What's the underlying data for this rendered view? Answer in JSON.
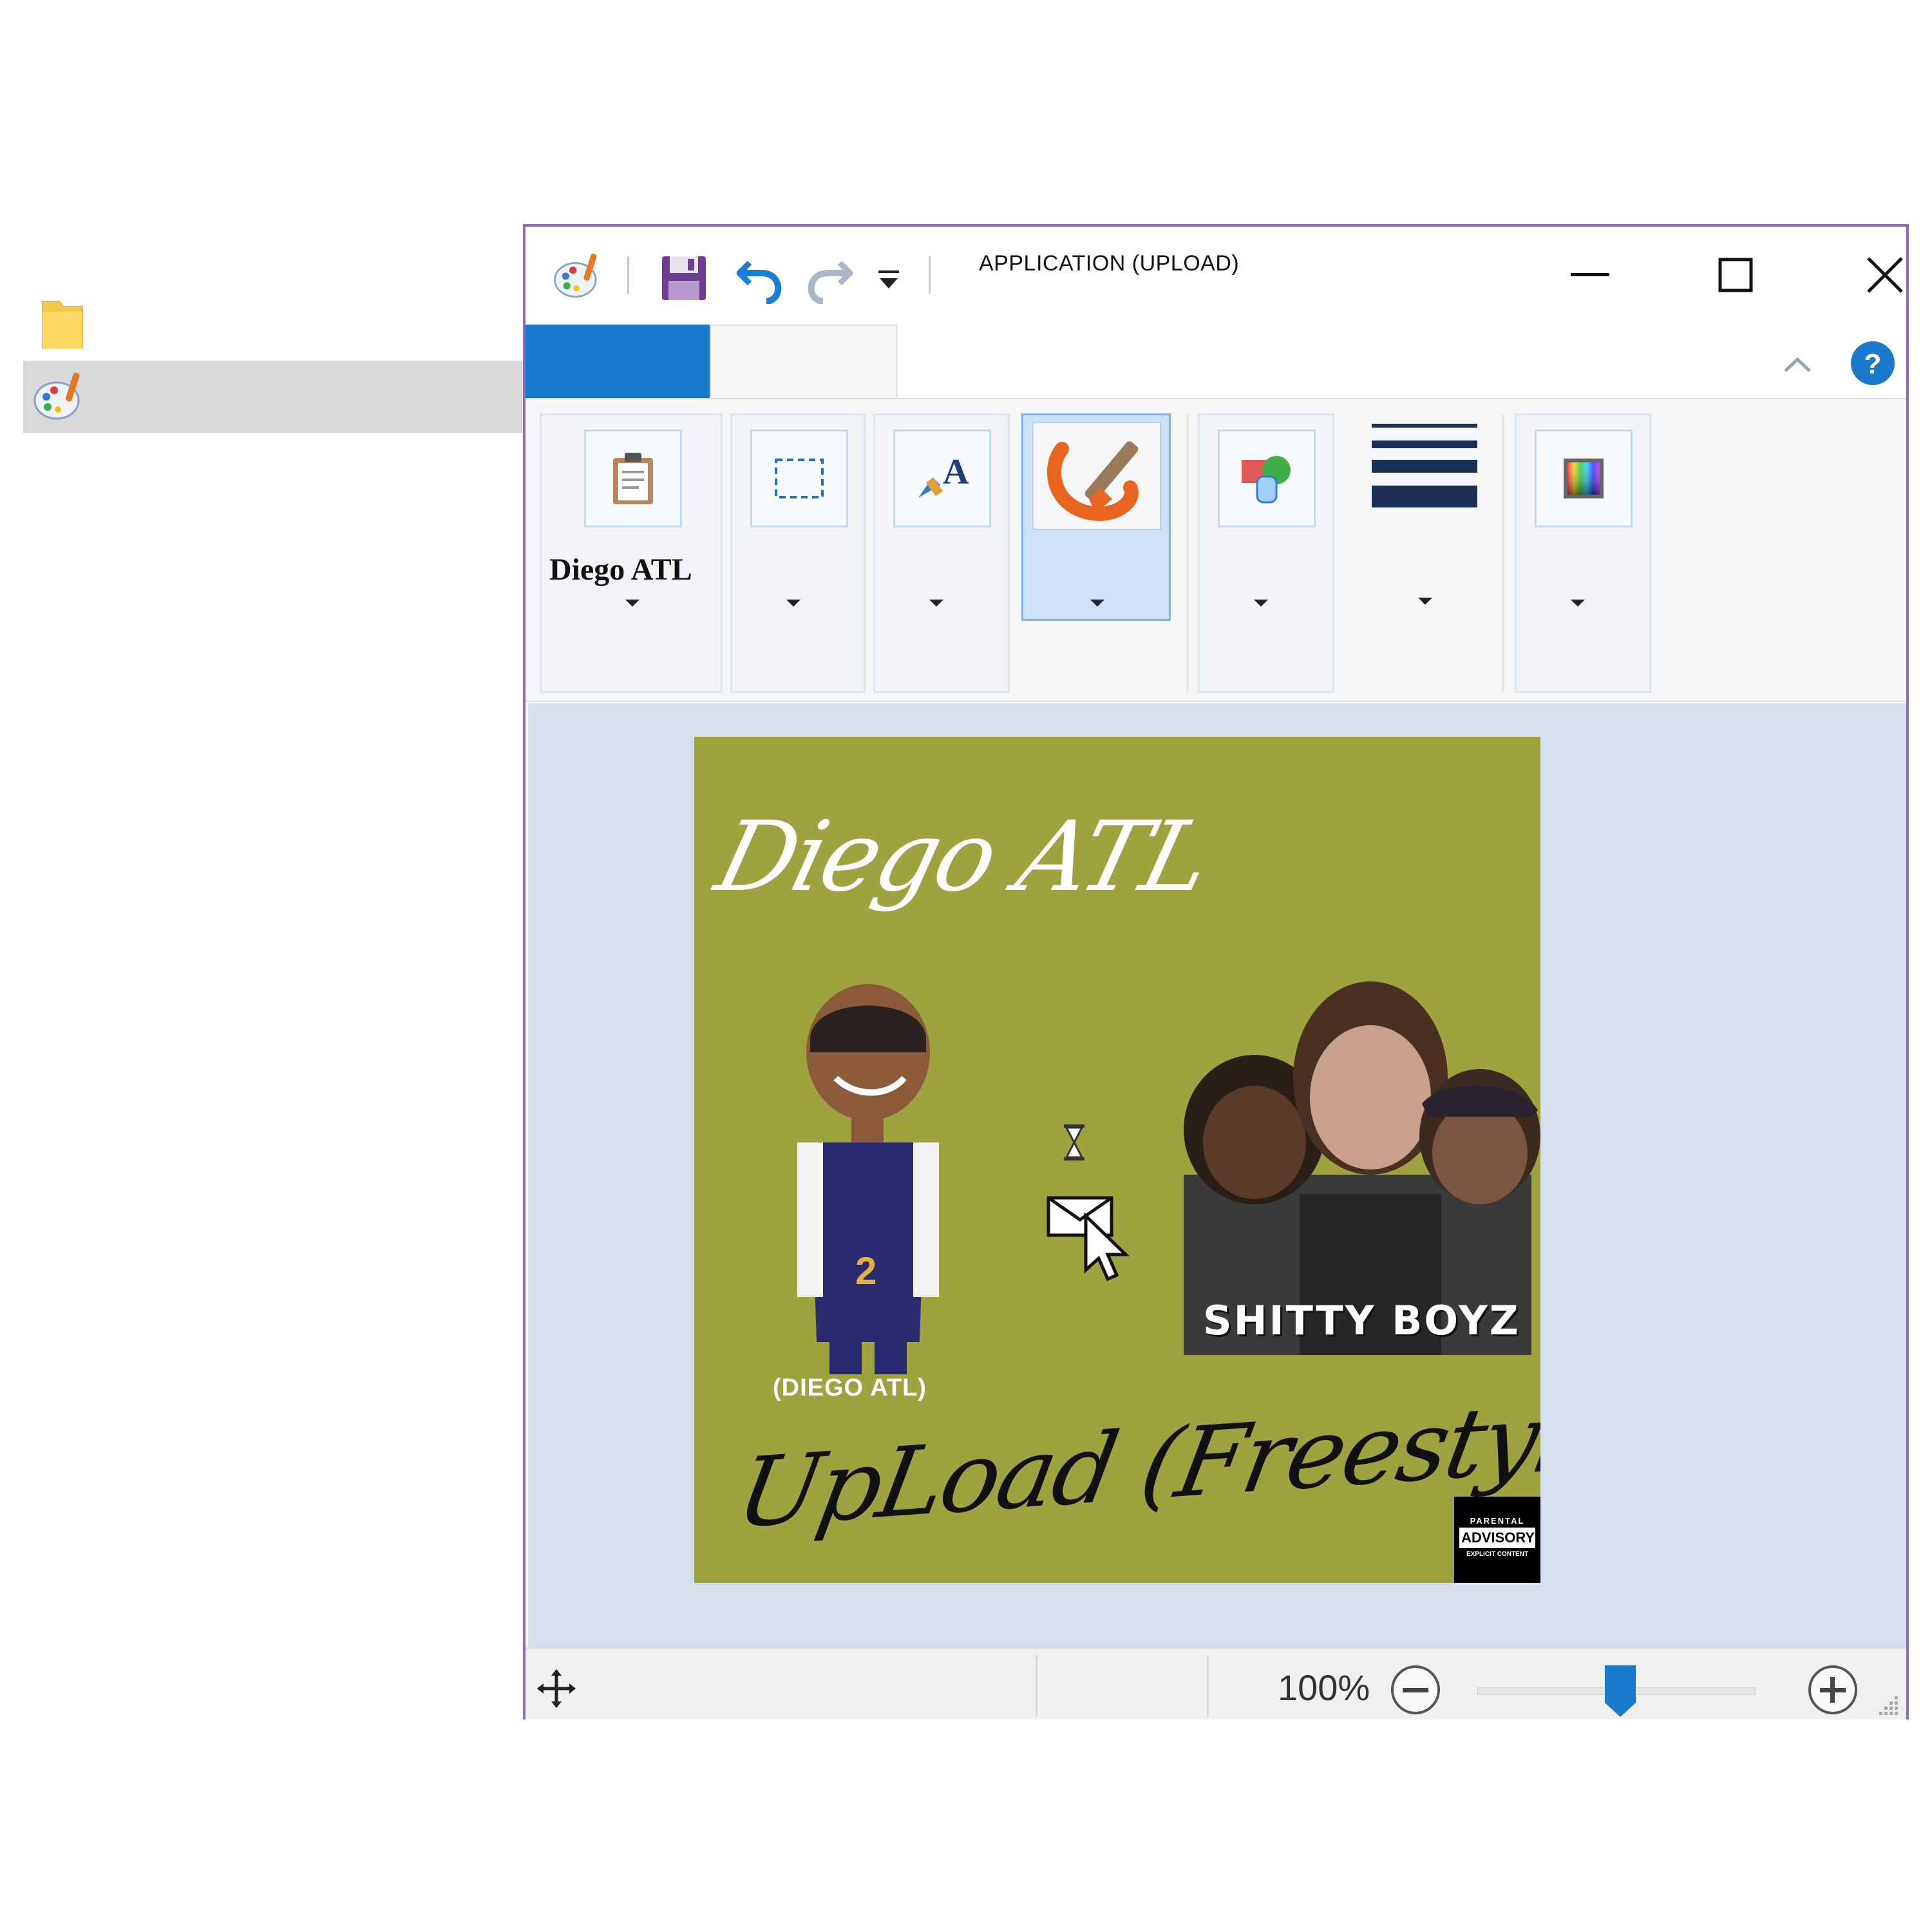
{
  "window": {
    "title": "APPLICATION (UPLOAD)"
  },
  "ribbon": {
    "clipboard_label": "Diego ATL"
  },
  "artwork": {
    "title_script": "Diego ATL",
    "caption": "(DIEGO ATL)",
    "group_label": "SHITTY BOYZ",
    "track_title": "UpLoad (Freestyle)",
    "advisory_line1": "PARENTAL",
    "advisory_line2": "ADVISORY",
    "advisory_line3": "EXPLICIT CONTENT"
  },
  "statusbar": {
    "zoom_level": "100%"
  },
  "colors": {
    "accent": "#1979ca",
    "window_border": "#8c6cb8",
    "artwork_background": "#9ea33f",
    "canvas_background": "#d7e1ee"
  }
}
